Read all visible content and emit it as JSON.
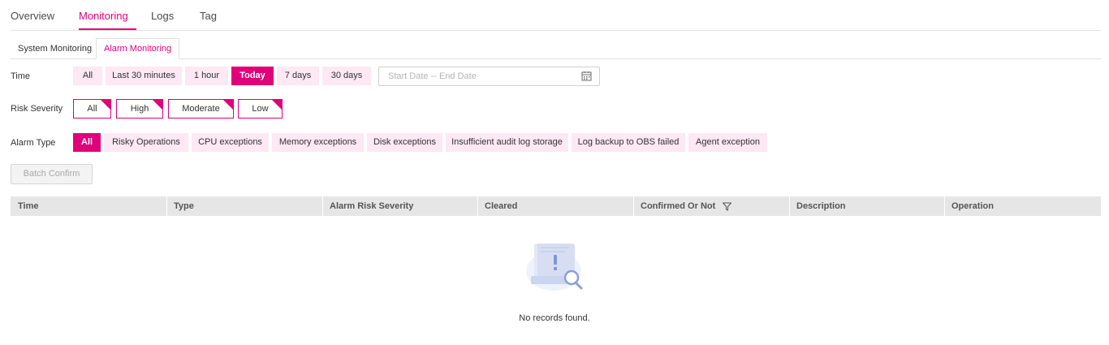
{
  "top_tabs": [
    {
      "label": "Overview"
    },
    {
      "label": "Monitoring"
    },
    {
      "label": "Logs"
    },
    {
      "label": "Tag"
    }
  ],
  "sub_tabs": [
    {
      "label": "System Monitoring"
    },
    {
      "label": "Alarm Monitoring"
    }
  ],
  "filters": {
    "time_label": "Time",
    "time_options": [
      "All",
      "Last 30 minutes",
      "1 hour",
      "Today",
      "7 days",
      "30 days"
    ],
    "time_selected": "Today",
    "date_range_placeholder": "Start Date -- End Date",
    "risk_label": "Risk Severity",
    "risk_options": [
      "All",
      "High",
      "Moderate",
      "Low"
    ],
    "alarm_type_label": "Alarm Type",
    "alarm_type_options": [
      "All",
      "Risky Operations",
      "CPU exceptions",
      "Memory exceptions",
      "Disk exceptions",
      "Insufficient audit log storage",
      "Log backup to OBS failed",
      "Agent exception"
    ],
    "alarm_type_selected": "All"
  },
  "batch_confirm_label": "Batch Confirm",
  "table": {
    "columns": [
      "Time",
      "Type",
      "Alarm Risk Severity",
      "Cleared",
      "Confirmed Or Not",
      "Description",
      "Operation"
    ],
    "empty_text": "No records found."
  },
  "colors": {
    "accent": "#e0007a",
    "accent_light": "#fde8f3",
    "header_bg": "#e6e6e6"
  }
}
